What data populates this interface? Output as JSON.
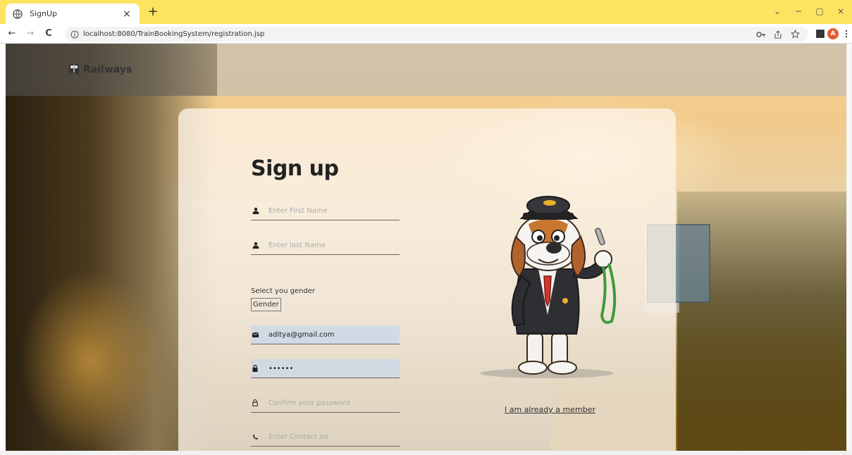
{
  "browser": {
    "tab_title": "SignUp",
    "tab_close": "×",
    "new_tab": "+",
    "url": "localhost:8080/TrainBookingSystem/registration.jsp",
    "win_min": "−",
    "win_max": "▢",
    "win_close": "×",
    "win_dropdown": "⌄",
    "profile_initial": "A"
  },
  "nav": {
    "back": "←",
    "forward": "→",
    "reload": "C"
  },
  "site": {
    "brand": "Railways",
    "brand_color": "#333333"
  },
  "form": {
    "heading": "Sign up",
    "first_name": {
      "placeholder": "Enter First Name",
      "value": ""
    },
    "last_name": {
      "placeholder": "Enter last Name",
      "value": ""
    },
    "gender_label": "Select you gender",
    "gender_select": "Gender",
    "email": {
      "placeholder": "",
      "value": "aditya@gmail.com"
    },
    "password": {
      "placeholder": "",
      "value": "••••••"
    },
    "confirm_password": {
      "placeholder": "Confirm your password",
      "value": ""
    },
    "contact": {
      "placeholder": "Enter Contact no",
      "value": ""
    },
    "member_link": "I am already a member"
  },
  "icons": {
    "favicon": "globe-icon",
    "first_name": "user-icon",
    "last_name": "user-icon",
    "email": "envelope-icon",
    "password": "lock-icon",
    "confirm_password": "lock-outline-icon",
    "contact": "phone-icon"
  }
}
